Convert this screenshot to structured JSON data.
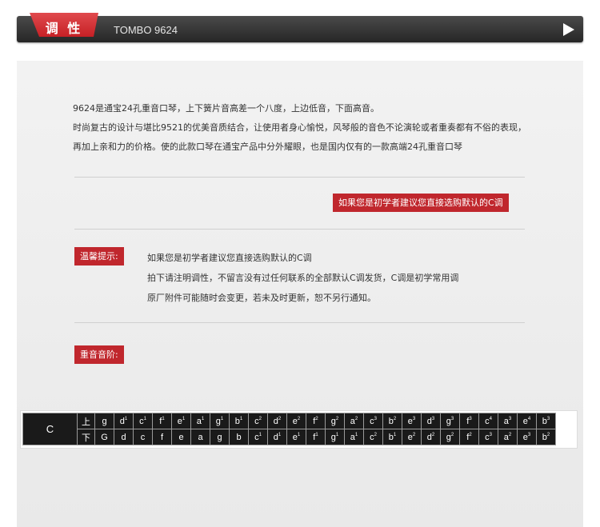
{
  "header": {
    "tab_label": "调 性",
    "model": "TOMBO 9624"
  },
  "intro": {
    "lines": [
      "9624是通宝24孔重音口琴，上下簧片音高差一个八度，上边低音，下面高音。",
      "时尚复古的设计与堪比9521的优美音质结合，让使用者身心愉悦，风琴般的音色不论演轮或者重奏都有不俗的表现，",
      "再加上亲和力的价格。使的此款口琴在通宝产品中分外耀眼，也是国内仅有的一款高端24孔重音口琴"
    ]
  },
  "recommend_label": "如果您是初学者建议您直接选购默认的C调",
  "tips": {
    "label": "温馨提示:",
    "lines": [
      "如果您是初学者建议您直接选购默认的C调",
      "拍下请注明调性，不留言没有过任何联系的全部默认C调发货，C调是初学常用调",
      "原厂附件可能随时会变更，若未及时更新，恕不另行通知。"
    ]
  },
  "scale_label": "重音音阶:",
  "notes": {
    "key": "C",
    "upper_label": "上",
    "lower_label": "下",
    "upper": [
      [
        "g",
        ""
      ],
      [
        "d",
        "1"
      ],
      [
        "c",
        "1"
      ],
      [
        "f",
        "1"
      ],
      [
        "e",
        "1"
      ],
      [
        "a",
        "1"
      ],
      [
        "g",
        "1"
      ],
      [
        "b",
        "1"
      ],
      [
        "c",
        "2"
      ],
      [
        "d",
        "2"
      ],
      [
        "e",
        "2"
      ],
      [
        "f",
        "2"
      ],
      [
        "g",
        "2"
      ],
      [
        "a",
        "2"
      ],
      [
        "c",
        "3"
      ],
      [
        "b",
        "2"
      ],
      [
        "e",
        "3"
      ],
      [
        "d",
        "3"
      ],
      [
        "g",
        "3"
      ],
      [
        "f",
        "3"
      ],
      [
        "c",
        "4"
      ],
      [
        "a",
        "3"
      ],
      [
        "e",
        "4"
      ],
      [
        "b",
        "3"
      ]
    ],
    "lower": [
      [
        "G",
        ""
      ],
      [
        "d",
        ""
      ],
      [
        "c",
        ""
      ],
      [
        "f",
        ""
      ],
      [
        "e",
        ""
      ],
      [
        "a",
        ""
      ],
      [
        "g",
        ""
      ],
      [
        "b",
        ""
      ],
      [
        "c",
        "1"
      ],
      [
        "d",
        "1"
      ],
      [
        "e",
        "1"
      ],
      [
        "f",
        "1"
      ],
      [
        "g",
        "1"
      ],
      [
        "a",
        "1"
      ],
      [
        "c",
        "2"
      ],
      [
        "b",
        "1"
      ],
      [
        "e",
        "2"
      ],
      [
        "d",
        "2"
      ],
      [
        "g",
        "2"
      ],
      [
        "f",
        "2"
      ],
      [
        "c",
        "3"
      ],
      [
        "a",
        "2"
      ],
      [
        "e",
        "3"
      ],
      [
        "b",
        "2"
      ]
    ]
  }
}
